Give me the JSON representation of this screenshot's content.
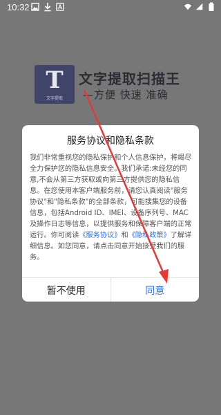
{
  "status_bar": {
    "time": "10:32",
    "left_icons": [
      "image-icon",
      "download-icon",
      "a-icon"
    ],
    "right_icons": [
      "wifi-icon",
      "signal-icon",
      "battery-icon"
    ]
  },
  "app": {
    "logo_letter": "T",
    "logo_subtext": "文字提取",
    "title": "文字提取扫描王",
    "slogan": "—方便 快速 准确"
  },
  "dialog": {
    "title": "服务协议和隐私条款",
    "body_part1": "我们非常重视您的隐私保护和个人信息保护，将竭尽全力保护您的隐私信息安全。我们承诺:未经您的同意,不会从第三方获取或向第三方提供您的隐私信息。在您使用本客户端服务前，请您认真阅读\"服务协议\"和\"隐私条款\"的全部条款，可能搜集您的设备信息，包括Android ID、IMEI、设备序列号、MAC及操作日志等信息，以提供服务和保障客户端的正常运行。你可阅读",
    "link_service": "《服务协议》",
    "body_and": "和",
    "link_privacy": "《隐私政策》",
    "body_part2": "了解详细信息。如您同意，请点击同意开始接受我们的服务。",
    "cancel_label": "暂不使用",
    "agree_label": "同意"
  },
  "colors": {
    "overlay": "#777777",
    "logo_bg": "#3f4468",
    "link": "#2f6fe0",
    "annotation_arrow": "#e53935"
  }
}
